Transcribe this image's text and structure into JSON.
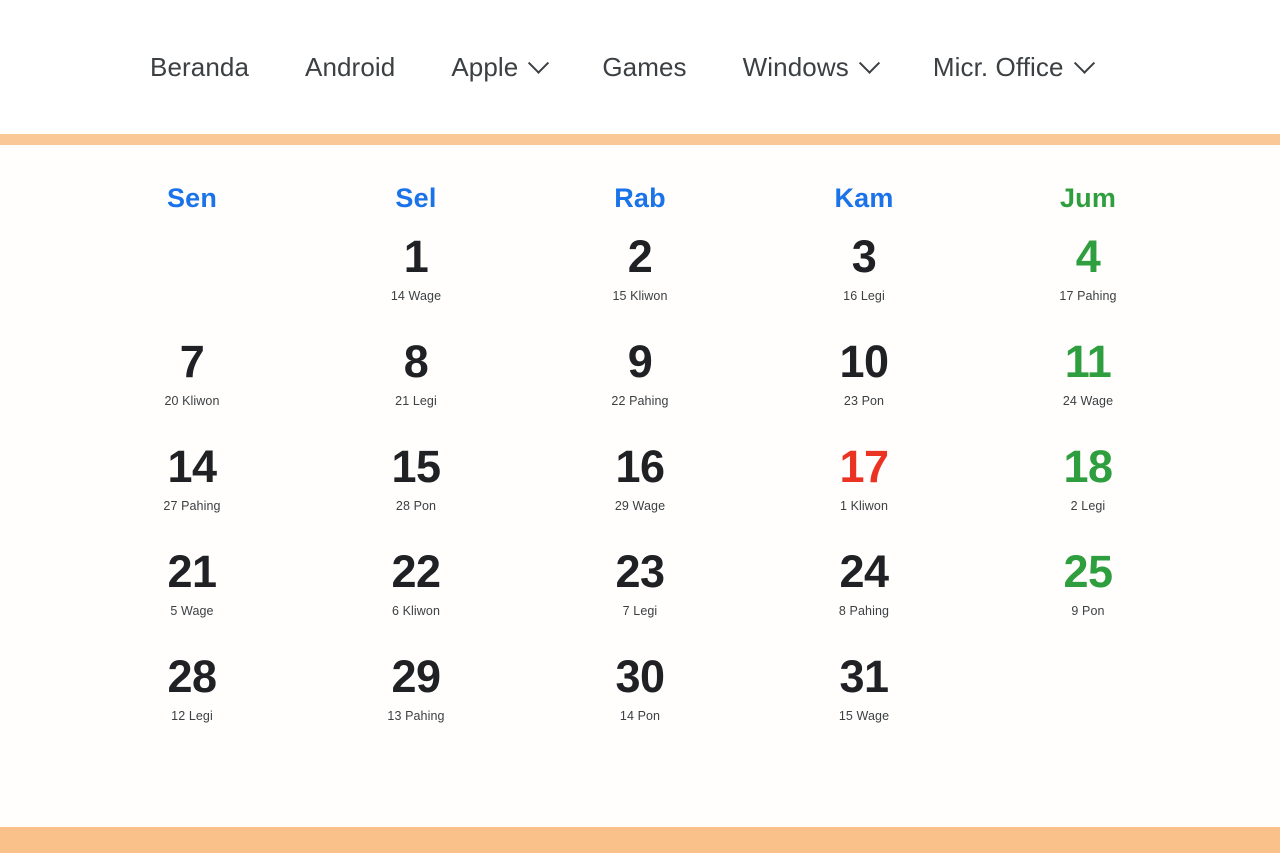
{
  "colors": {
    "blue": "#1a73e8",
    "green": "#2e9e3e",
    "red": "#ea3323",
    "dark": "#202124",
    "orange_rule_top": "#fac896",
    "orange_rule_bottom": "#fbc18a",
    "nav_text": "#3c4043",
    "page_bg": "#fffefd"
  },
  "nav": {
    "items": [
      {
        "label": "Beranda",
        "has_dropdown": false,
        "icon": ""
      },
      {
        "label": "Android",
        "has_dropdown": false,
        "icon": ""
      },
      {
        "label": "Apple",
        "has_dropdown": true,
        "icon": "chevron-down-icon"
      },
      {
        "label": "Games",
        "has_dropdown": false,
        "icon": ""
      },
      {
        "label": "Windows",
        "has_dropdown": true,
        "icon": "chevron-down-icon"
      },
      {
        "label": "Micr. Office",
        "has_dropdown": true,
        "icon": "chevron-down-icon"
      }
    ]
  },
  "calendar": {
    "day_headers": [
      {
        "label": "Sen",
        "color": "blue"
      },
      {
        "label": "Sel",
        "color": "blue"
      },
      {
        "label": "Rab",
        "color": "blue"
      },
      {
        "label": "Kam",
        "color": "blue"
      },
      {
        "label": "Jum",
        "color": "green"
      }
    ],
    "weeks": [
      [
        {
          "day": "",
          "pasaran": "",
          "color": "dark",
          "empty": true
        },
        {
          "day": "1",
          "pasaran": "14 Wage",
          "color": "dark",
          "empty": false
        },
        {
          "day": "2",
          "pasaran": "15 Kliwon",
          "color": "dark",
          "empty": false
        },
        {
          "day": "3",
          "pasaran": "16 Legi",
          "color": "dark",
          "empty": false
        },
        {
          "day": "4",
          "pasaran": "17 Pahing",
          "color": "green",
          "empty": false
        }
      ],
      [
        {
          "day": "7",
          "pasaran": "20 Kliwon",
          "color": "dark",
          "empty": false
        },
        {
          "day": "8",
          "pasaran": "21 Legi",
          "color": "dark",
          "empty": false
        },
        {
          "day": "9",
          "pasaran": "22 Pahing",
          "color": "dark",
          "empty": false
        },
        {
          "day": "10",
          "pasaran": "23 Pon",
          "color": "dark",
          "empty": false
        },
        {
          "day": "11",
          "pasaran": "24 Wage",
          "color": "green",
          "empty": false
        }
      ],
      [
        {
          "day": "14",
          "pasaran": "27 Pahing",
          "color": "dark",
          "empty": false
        },
        {
          "day": "15",
          "pasaran": "28 Pon",
          "color": "dark",
          "empty": false
        },
        {
          "day": "16",
          "pasaran": "29 Wage",
          "color": "dark",
          "empty": false
        },
        {
          "day": "17",
          "pasaran": "1 Kliwon",
          "color": "red",
          "empty": false
        },
        {
          "day": "18",
          "pasaran": "2 Legi",
          "color": "green",
          "empty": false
        }
      ],
      [
        {
          "day": "21",
          "pasaran": "5 Wage",
          "color": "dark",
          "empty": false
        },
        {
          "day": "22",
          "pasaran": "6 Kliwon",
          "color": "dark",
          "empty": false
        },
        {
          "day": "23",
          "pasaran": "7 Legi",
          "color": "dark",
          "empty": false
        },
        {
          "day": "24",
          "pasaran": "8 Pahing",
          "color": "dark",
          "empty": false
        },
        {
          "day": "25",
          "pasaran": "9 Pon",
          "color": "green",
          "empty": false
        }
      ],
      [
        {
          "day": "28",
          "pasaran": "12 Legi",
          "color": "dark",
          "empty": false
        },
        {
          "day": "29",
          "pasaran": "13 Pahing",
          "color": "dark",
          "empty": false
        },
        {
          "day": "30",
          "pasaran": "14 Pon",
          "color": "dark",
          "empty": false
        },
        {
          "day": "31",
          "pasaran": "15 Wage",
          "color": "dark",
          "empty": false
        },
        {
          "day": "",
          "pasaran": "",
          "color": "dark",
          "empty": true
        }
      ]
    ]
  }
}
